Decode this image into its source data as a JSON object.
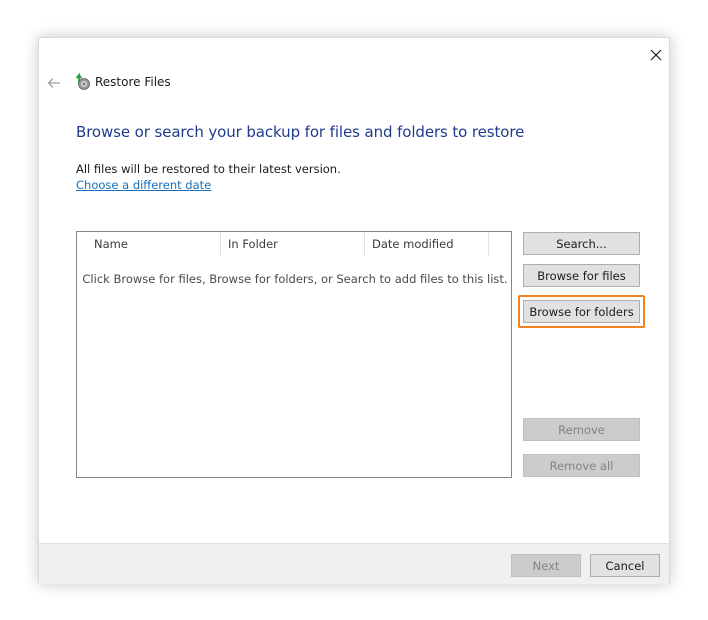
{
  "window": {
    "title": "Restore Files",
    "close_icon": "close-icon",
    "back_icon": "arrow-left-icon"
  },
  "main": {
    "heading": "Browse or search your backup for files and folders to restore",
    "info": "All files will be restored to their latest version.",
    "date_link": "Choose a different date"
  },
  "file_list": {
    "columns": [
      "Name",
      "In Folder",
      "Date modified"
    ],
    "empty_message": "Click Browse for files, Browse for folders, or Search to add files to this list."
  },
  "side_buttons": {
    "search": "Search...",
    "browse_files": "Browse for files",
    "browse_folders": "Browse for folders",
    "remove": "Remove",
    "remove_all": "Remove all"
  },
  "footer": {
    "next": "Next",
    "cancel": "Cancel"
  },
  "colors": {
    "heading": "#1e3c8c",
    "link": "#1a6fb8",
    "highlight": "#f5821f"
  }
}
